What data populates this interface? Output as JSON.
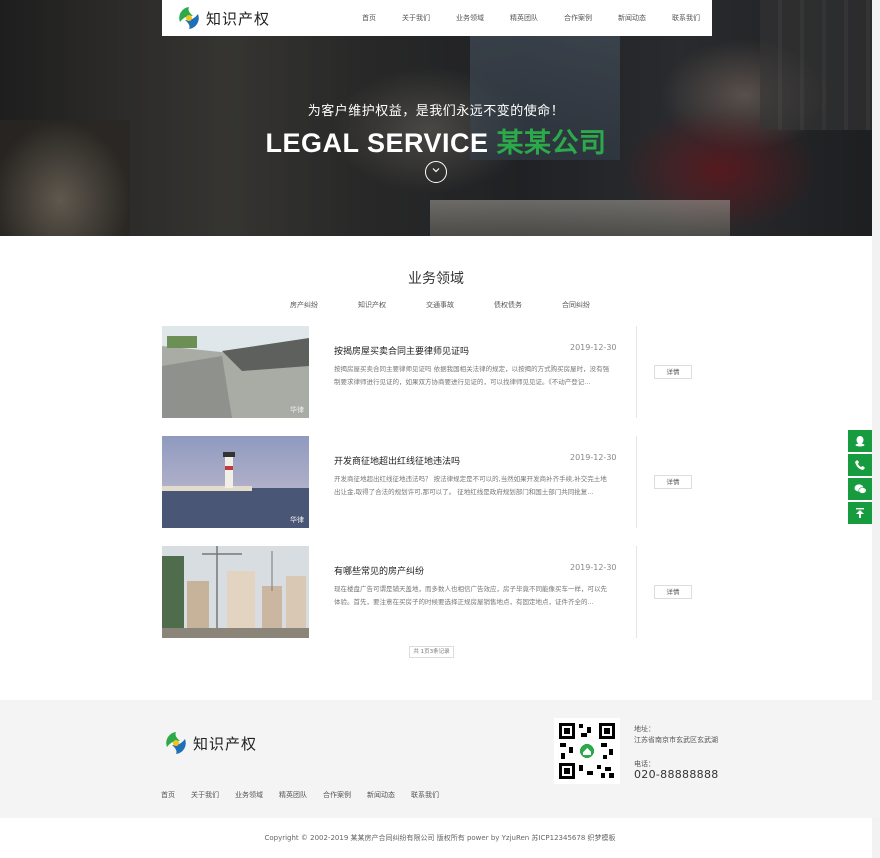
{
  "brand": {
    "name": "知识产权",
    "accent": "#2ca94a"
  },
  "nav": {
    "items": [
      "首页",
      "关于我们",
      "业务领域",
      "精英团队",
      "合作案例",
      "新闻动态",
      "联系我们"
    ]
  },
  "hero": {
    "tagline": "为客户维护权益，是我们永远不变的使命！",
    "title_en": "LEGAL SERVICE",
    "title_cn": "某某公司",
    "scroll_icon": "chevron-down-icon"
  },
  "section": {
    "title": "业务领域",
    "categories": [
      "房产纠纷",
      "知识产权",
      "交通事故",
      "债权债务",
      "合同纠纷"
    ]
  },
  "news": [
    {
      "title": "按揭房屋买卖合同主要律师见证吗",
      "date": "2019-12-30",
      "desc": "按揭房屋买卖合同主要律师见证吗 依据我国相关法律的规定，以按揭的方式购买房屋时，没有强制要求律师进行见证的，如果双方协商要进行见证的，可以找律师见见证。《不动产登记...",
      "detail": "详情"
    },
    {
      "title": "开发商征地超出红线征地违法吗",
      "date": "2019-12-30",
      "desc": "开发商征地超出红线征地违法吗？ 按法律规定是不可以的,当然如果开发商补齐手续,补交完土地出让金,取得了合法的规划许可,那可以了。 征地红线是政府规划部门和国土部门共同批复...",
      "detail": "详情"
    },
    {
      "title": "有哪些常见的房产纠纷",
      "date": "2019-12-30",
      "desc": "现在楼盘广告可谓是铺天盖地，而多数人也相信广告效应，房子毕竟不同能像买车一样，可以先体验。首先，要注意在买房子的时候要选择正规房屋销售地点，有固定地点，证件齐全的...",
      "detail": "详情"
    }
  ],
  "pager": {
    "text": "共 1页3条记录"
  },
  "footer": {
    "links": [
      "首页",
      "关于我们",
      "业务领域",
      "精英团队",
      "合作案例",
      "新闻动态",
      "联系我们"
    ],
    "address_label": "地址：",
    "address": "江苏省南京市玄武区玄武湖",
    "tel_label": "电话：",
    "tel": "020-88888888",
    "copyright": "Copyright © 2002-2019 某某房产合同纠纷有限公司 版权所有 power by YzjuRen  苏ICP12345678  织梦模板"
  },
  "side_tools": [
    "qq-icon",
    "phone-icon",
    "wechat-icon",
    "back-to-top-icon"
  ],
  "colors": {
    "green": "#169c3e"
  }
}
